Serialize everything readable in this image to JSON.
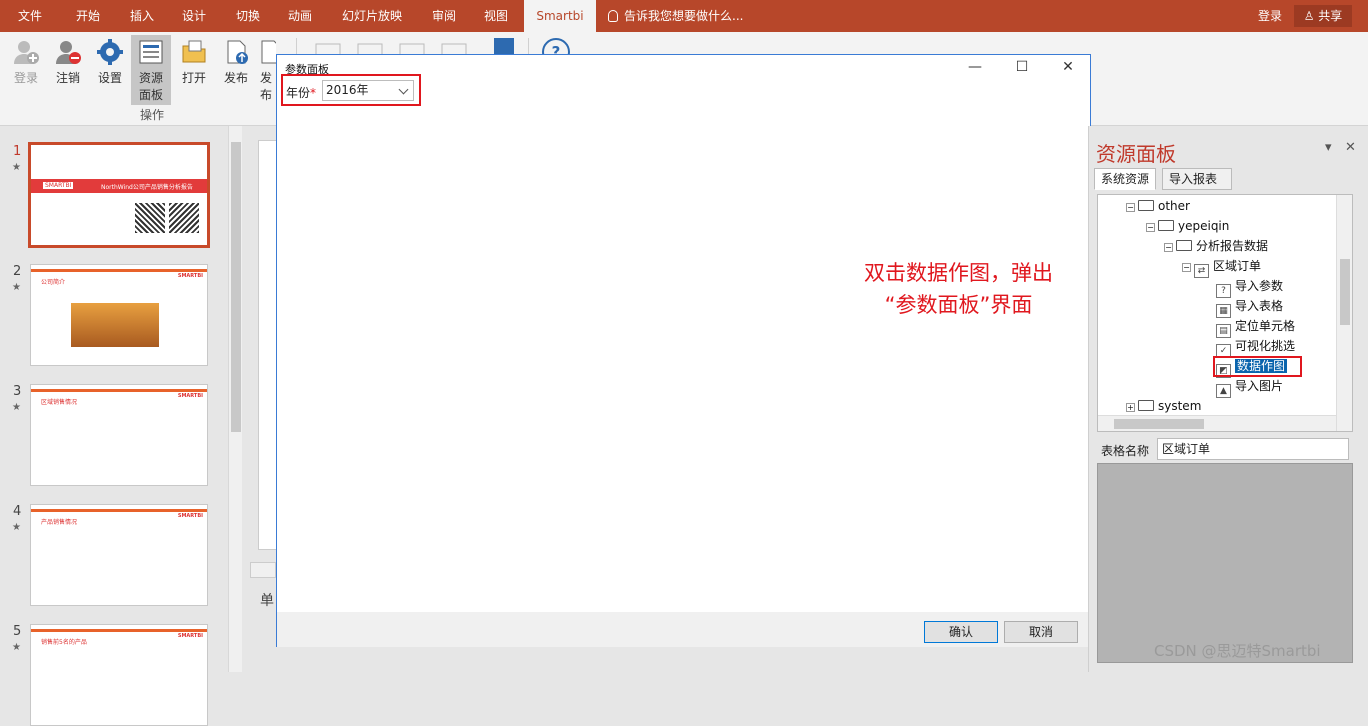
{
  "menu": {
    "tabs": [
      "文件",
      "开始",
      "插入",
      "设计",
      "切换",
      "动画",
      "幻灯片放映",
      "审阅",
      "视图",
      "Smartbi"
    ],
    "tell_me": "告诉我您想要做什么...",
    "login": "登录",
    "share": "共享"
  },
  "ribbon": {
    "buttons": [
      "登录",
      "注销",
      "设置",
      "资源面板",
      "打开",
      "发布",
      "发布"
    ],
    "resource_line1": "资源",
    "resource_line2": "面板",
    "group_label": "操作"
  },
  "slides": {
    "numbers": [
      "1",
      "2",
      "3",
      "4",
      "5"
    ],
    "star": "★",
    "thumb_titles": [
      "NorthWind公司产品销售分析报告",
      "公司简介",
      "区域销售情况",
      "产品销售情况",
      "销售前5名的产品"
    ]
  },
  "dialog": {
    "title": "参数面板",
    "param_label": "年份",
    "required_mark": "*",
    "year_value": "2016年",
    "ok": "确认",
    "cancel": "取消"
  },
  "annotation": {
    "line1": "双击数据作图，弹出",
    "line2": "“参数面板”界面"
  },
  "resource_panel": {
    "title": "资源面板",
    "tabs": [
      "系统资源",
      "导入报表"
    ],
    "tree": {
      "other": "other",
      "yepeiqin": "yepeiqin",
      "report_data": "分析报告数据",
      "region_order": "区域订单",
      "import_param": "导入参数",
      "import_table": "导入表格",
      "locate_cell": "定位单元格",
      "visual_filter": "可视化挑选",
      "data_chart": "数据作图",
      "import_image": "导入图片",
      "system": "system"
    },
    "table_name_label": "表格名称",
    "table_name_value": "区域订单"
  },
  "canvas": {
    "partial_text": "单"
  },
  "watermark": "CSDN @思迈特Smartbi",
  "colors": {
    "accent": "#b7472a",
    "highlight": "#e0171e",
    "selection": "#0a64ad"
  }
}
